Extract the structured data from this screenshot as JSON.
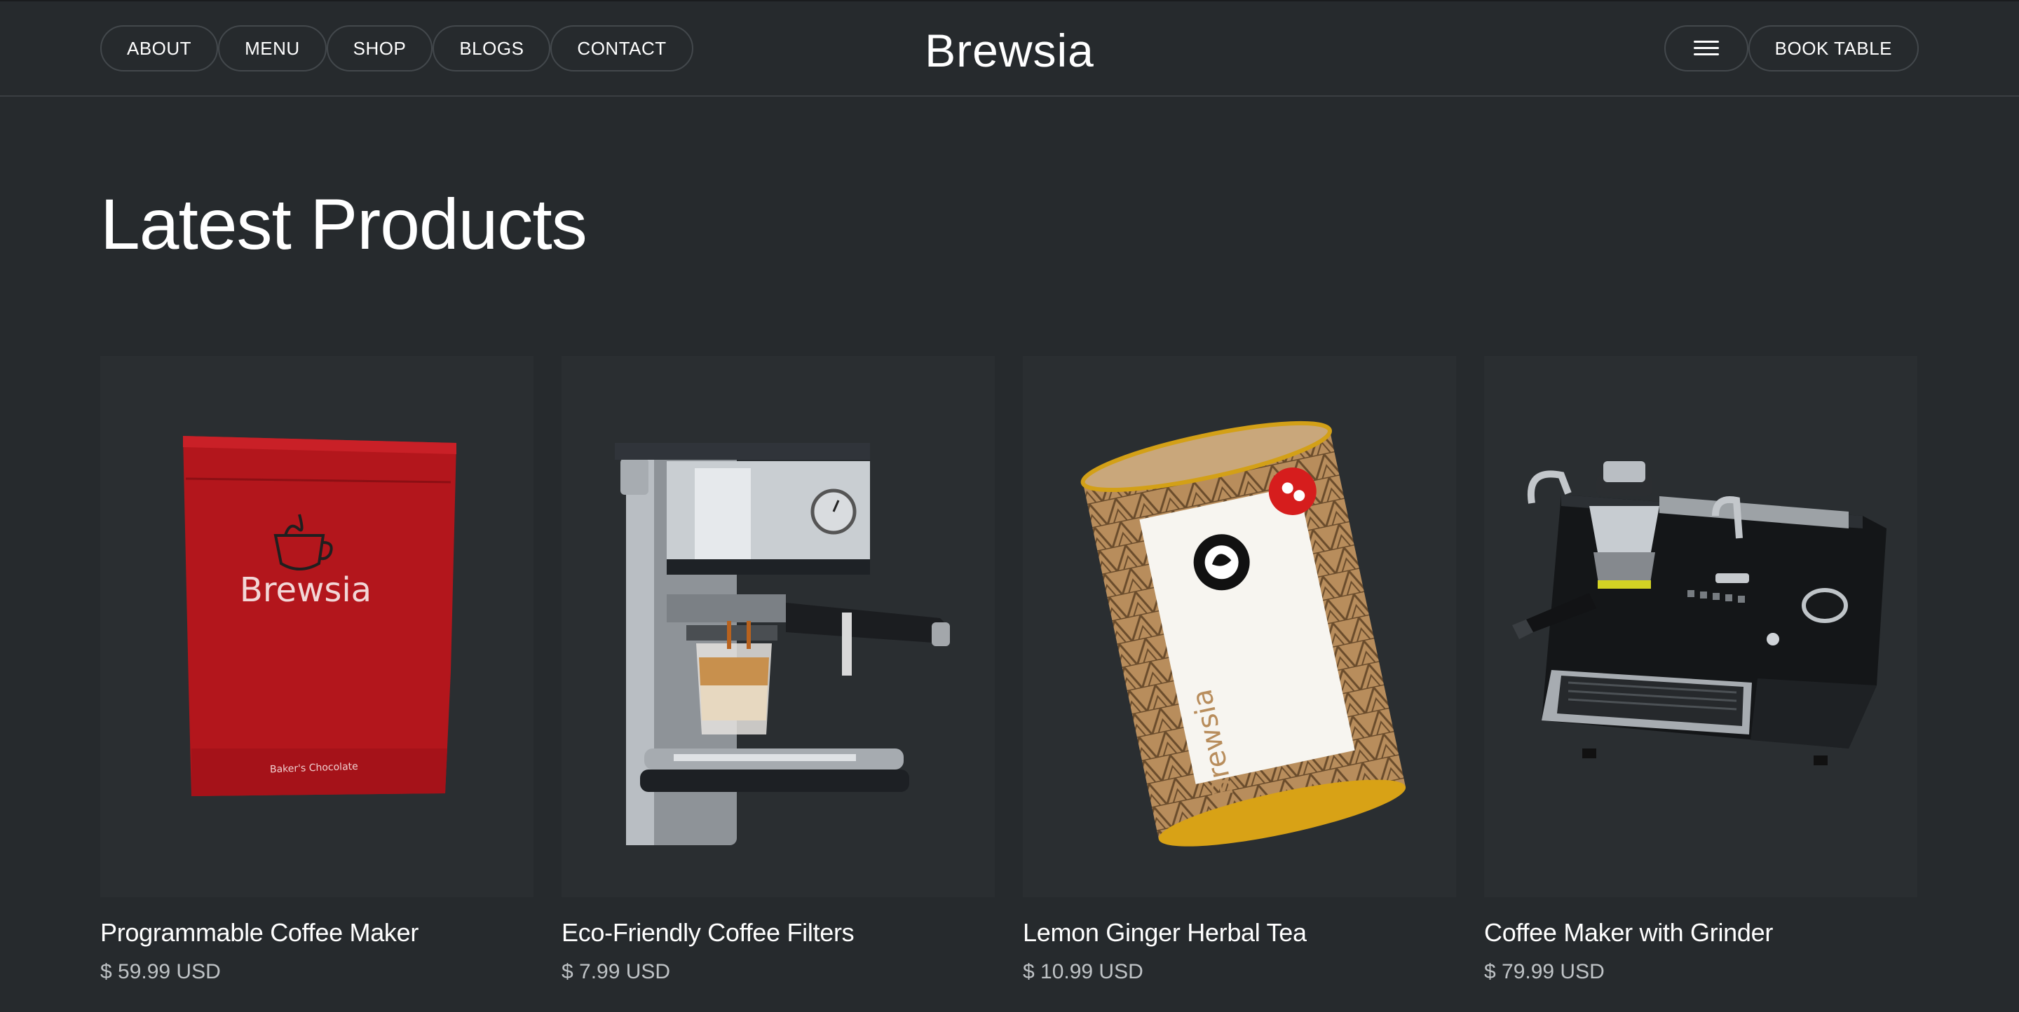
{
  "nav": {
    "links": [
      "ABOUT",
      "MENU",
      "SHOP",
      "BLOGS",
      "CONTACT"
    ],
    "brand": "Brewsia",
    "book_label": "BOOK TABLE"
  },
  "section": {
    "title": "Latest Products"
  },
  "products": [
    {
      "name": "Programmable Coffee Maker",
      "price": "$ 59.99 USD",
      "image": "red coffee bag",
      "image_text": {
        "brand": "Brewsia",
        "subtitle": "Baker's Chocolate"
      }
    },
    {
      "name": "Eco-Friendly Coffee Filters",
      "price": "$ 7.99 USD",
      "image": "espresso machine"
    },
    {
      "name": "Lemon Ginger Herbal Tea",
      "price": "$ 10.99 USD",
      "image": "tea canister",
      "image_text": {
        "brand": "Brewsia"
      }
    },
    {
      "name": "Coffee Maker with Grinder",
      "price": "$ 79.99 USD",
      "image": "black espresso machine"
    }
  ],
  "colors": {
    "background": "#262a2d",
    "card": "#2a2e31",
    "price": "#bfc3c6",
    "pill_border": "#43484c"
  }
}
